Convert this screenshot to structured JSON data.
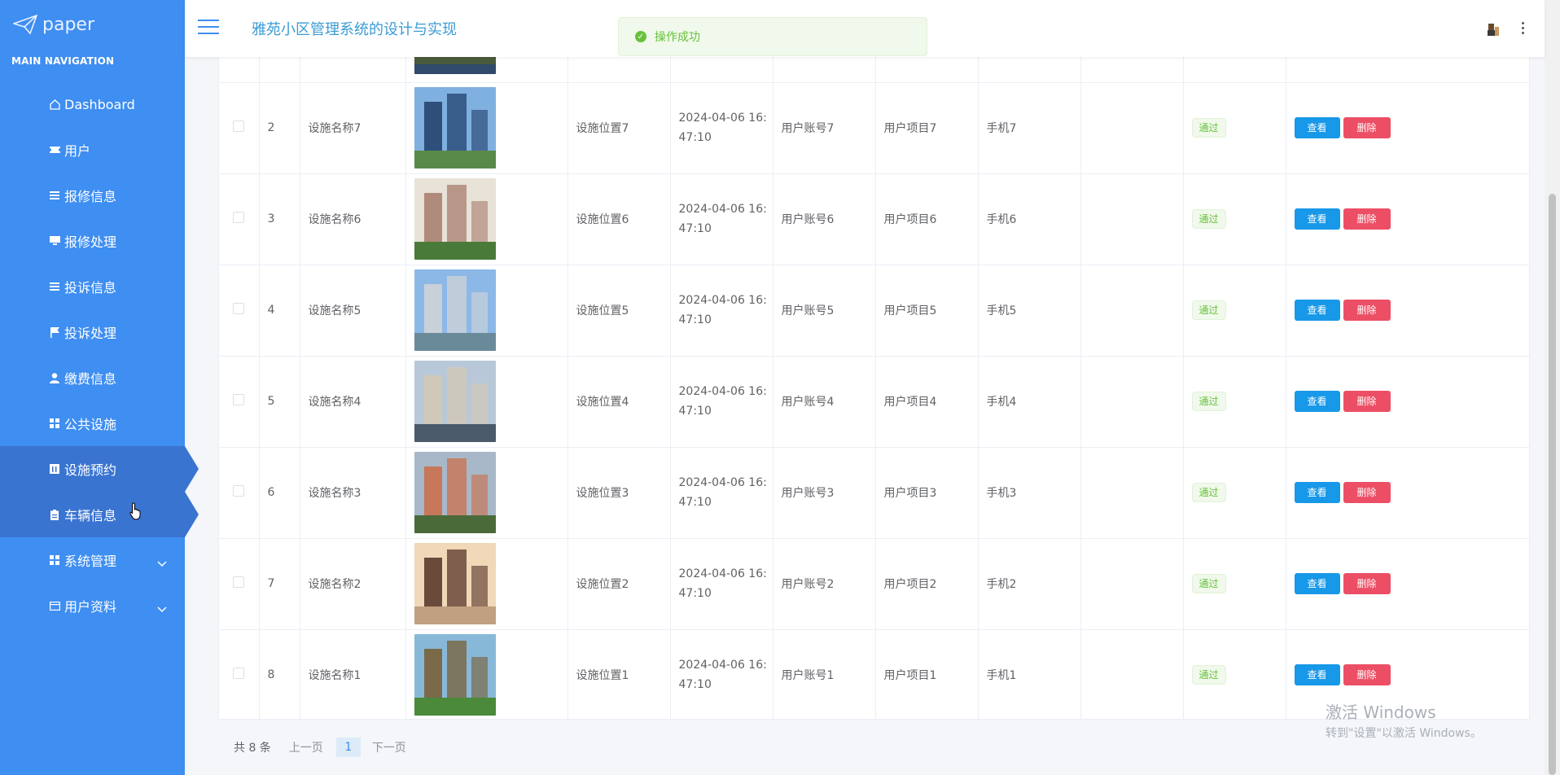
{
  "brand": {
    "name": "paper"
  },
  "sidebar": {
    "header": "MAIN NAVIGATION",
    "items": [
      {
        "label": "Dashboard",
        "icon": "home-icon"
      },
      {
        "label": "用户",
        "icon": "ticket-icon"
      },
      {
        "label": "报修信息",
        "icon": "list-icon"
      },
      {
        "label": "报修处理",
        "icon": "monitor-icon"
      },
      {
        "label": "投诉信息",
        "icon": "list-icon"
      },
      {
        "label": "投诉处理",
        "icon": "flag-icon"
      },
      {
        "label": "缴费信息",
        "icon": "user-icon"
      },
      {
        "label": "公共设施",
        "icon": "grid-icon"
      },
      {
        "label": "设施预约",
        "icon": "calendar-icon"
      },
      {
        "label": "车辆信息",
        "icon": "clipboard-icon"
      },
      {
        "label": "系统管理",
        "icon": "grid-icon"
      },
      {
        "label": "用户资料",
        "icon": "folder-icon"
      }
    ]
  },
  "topbar": {
    "title": "雅苑小区管理系统的设计与实现",
    "toast": "操作成功"
  },
  "table": {
    "status_color": "#67c23a",
    "rows": [
      {
        "index": "2",
        "name": "设施名称7",
        "location": "设施位置7",
        "time_line1": "2024-04-06 16:",
        "time_line2": "47:10",
        "account": "用户账号7",
        "project": "用户项目7",
        "phone": "手机7",
        "status": "通过",
        "view": "查看",
        "delete": "删除"
      },
      {
        "index": "3",
        "name": "设施名称6",
        "location": "设施位置6",
        "time_line1": "2024-04-06 16:",
        "time_line2": "47:10",
        "account": "用户账号6",
        "project": "用户项目6",
        "phone": "手机6",
        "status": "通过",
        "view": "查看",
        "delete": "删除"
      },
      {
        "index": "4",
        "name": "设施名称5",
        "location": "设施位置5",
        "time_line1": "2024-04-06 16:",
        "time_line2": "47:10",
        "account": "用户账号5",
        "project": "用户项目5",
        "phone": "手机5",
        "status": "通过",
        "view": "查看",
        "delete": "删除"
      },
      {
        "index": "5",
        "name": "设施名称4",
        "location": "设施位置4",
        "time_line1": "2024-04-06 16:",
        "time_line2": "47:10",
        "account": "用户账号4",
        "project": "用户项目4",
        "phone": "手机4",
        "status": "通过",
        "view": "查看",
        "delete": "删除"
      },
      {
        "index": "6",
        "name": "设施名称3",
        "location": "设施位置3",
        "time_line1": "2024-04-06 16:",
        "time_line2": "47:10",
        "account": "用户账号3",
        "project": "用户项目3",
        "phone": "手机3",
        "status": "通过",
        "view": "查看",
        "delete": "删除"
      },
      {
        "index": "7",
        "name": "设施名称2",
        "location": "设施位置2",
        "time_line1": "2024-04-06 16:",
        "time_line2": "47:10",
        "account": "用户账号2",
        "project": "用户项目2",
        "phone": "手机2",
        "status": "通过",
        "view": "查看",
        "delete": "删除"
      },
      {
        "index": "8",
        "name": "设施名称1",
        "location": "设施位置1",
        "time_line1": "2024-04-06 16:",
        "time_line2": "47:10",
        "account": "用户账号1",
        "project": "用户项目1",
        "phone": "手机1",
        "status": "通过",
        "view": "查看",
        "delete": "删除"
      }
    ]
  },
  "pagination": {
    "total": "共 8 条",
    "prev": "上一页",
    "current": "1",
    "next": "下一页"
  },
  "watermark": {
    "line1": "激活 Windows",
    "line2": "转到\"设置\"以激活 Windows。"
  }
}
